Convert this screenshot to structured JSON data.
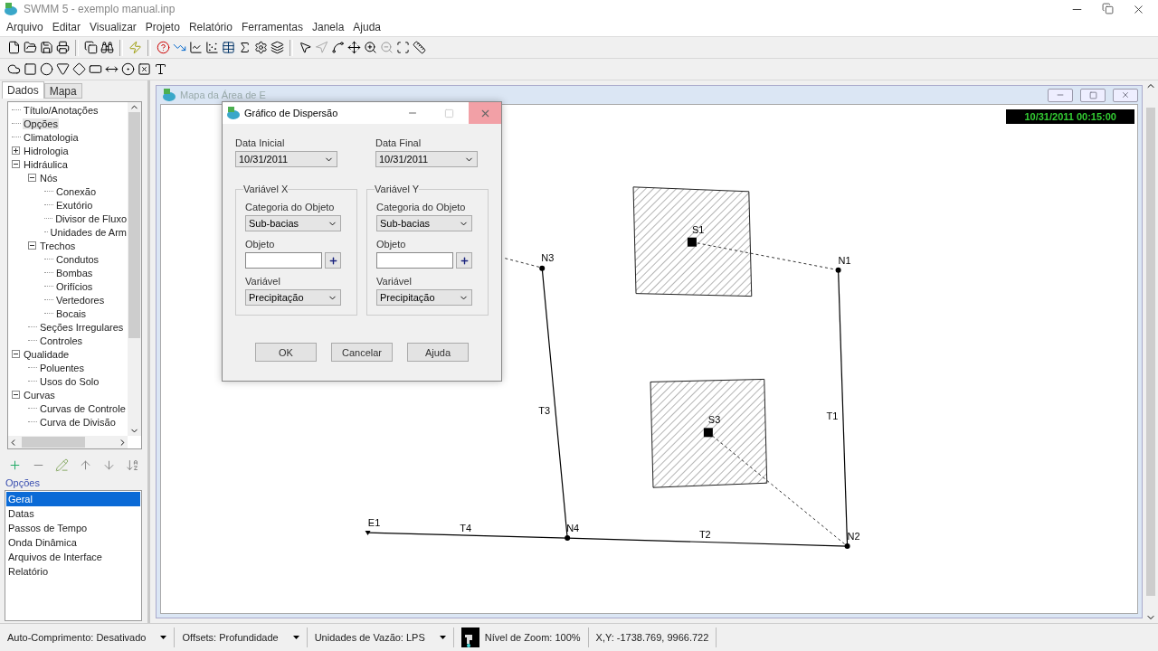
{
  "app": {
    "title": "SWMM 5 - exemplo manual.inp"
  },
  "menu": [
    "Arquivo",
    "Editar",
    "Visualizar",
    "Projeto",
    "Relatório",
    "Ferramentas",
    "Janela",
    "Ajuda"
  ],
  "browser": {
    "tabs": [
      {
        "label": "Dados",
        "selected": true
      },
      {
        "label": "Mapa",
        "selected": false
      }
    ],
    "tree": [
      {
        "label": "Título/Anotações",
        "selected": false
      },
      {
        "label": "Opções",
        "selected": true
      },
      {
        "label": "Climatologia",
        "selected": false
      },
      {
        "label": "Hidrologia",
        "selected": false,
        "expanded": false
      },
      {
        "label": "Hidráulica",
        "selected": false,
        "expanded": true,
        "children": [
          {
            "label": "Nós",
            "selected": false,
            "expanded": true,
            "children": [
              {
                "label": "Conexão",
                "selected": false
              },
              {
                "label": "Exutório",
                "selected": false
              },
              {
                "label": "Divisor de Fluxo",
                "selected": false
              },
              {
                "label": "Unidades de Arm",
                "selected": false
              }
            ]
          },
          {
            "label": "Trechos",
            "selected": false,
            "expanded": true,
            "children": [
              {
                "label": "Condutos",
                "selected": false
              },
              {
                "label": "Bombas",
                "selected": false
              },
              {
                "label": "Orifícios",
                "selected": false
              },
              {
                "label": "Vertedores",
                "selected": false
              },
              {
                "label": "Bocais",
                "selected": false
              }
            ]
          },
          {
            "label": "Seções Irregulares",
            "selected": false
          },
          {
            "label": "Controles",
            "selected": false
          }
        ]
      },
      {
        "label": "Qualidade",
        "selected": false,
        "expanded": true,
        "children": [
          {
            "label": "Poluentes",
            "selected": false
          },
          {
            "label": "Usos do Solo",
            "selected": false
          }
        ]
      },
      {
        "label": "Curvas",
        "selected": false,
        "expanded": true,
        "children": [
          {
            "label": "Curvas de Controle",
            "selected": false
          },
          {
            "label": "Curva de Divisão",
            "selected": false
          }
        ]
      }
    ],
    "section_label": "Opções",
    "items": [
      {
        "label": "Geral",
        "selected": true
      },
      {
        "label": "Datas",
        "selected": false
      },
      {
        "label": "Passos de Tempo",
        "selected": false
      },
      {
        "label": "Onda Dinâmica",
        "selected": false
      },
      {
        "label": "Arquivos de Interface",
        "selected": false
      },
      {
        "label": "Relatório",
        "selected": false
      }
    ]
  },
  "map_window": {
    "title": "Mapa da Área de E",
    "clock": "10/31/2011 00:15:00",
    "subcatchments": [
      "S1",
      "S3"
    ],
    "junctions": [
      "N1",
      "N2",
      "N3",
      "N4"
    ],
    "outfalls": [
      "E1"
    ],
    "conduits": [
      "T1",
      "T2",
      "T3",
      "T4"
    ]
  },
  "dialog": {
    "title": "Gráfico de Dispersão",
    "start_date": {
      "label": "Data Inicial",
      "value": "10/31/2011"
    },
    "end_date": {
      "label": "Data Final",
      "value": "10/31/2011"
    },
    "groups": [
      {
        "title": "Variável X",
        "category_label": "Categoria do Objeto",
        "category": "Sub-bacias",
        "object_label": "Objeto",
        "variable_label": "Variável",
        "variable": "Precipitação"
      },
      {
        "title": "Variável Y",
        "category_label": "Categoria do Objeto",
        "category": "Sub-bacias",
        "object_label": "Objeto",
        "variable_label": "Variável",
        "variable": "Precipitação"
      }
    ],
    "buttons": [
      "OK",
      "Cancelar",
      "Ajuda"
    ]
  },
  "status_bar": [
    {
      "kind": "dropdown",
      "text": "Auto-Comprimento: Desativado"
    },
    {
      "kind": "dropdown",
      "text": "Offsets: Profundidade"
    },
    {
      "kind": "dropdown",
      "text": "Unidades de Vazão: LPS"
    },
    {
      "kind": "zoom",
      "text": "Nível de Zoom: 100%"
    },
    {
      "kind": "text",
      "text": "X,Y: -1738.769, 9966.722"
    }
  ]
}
